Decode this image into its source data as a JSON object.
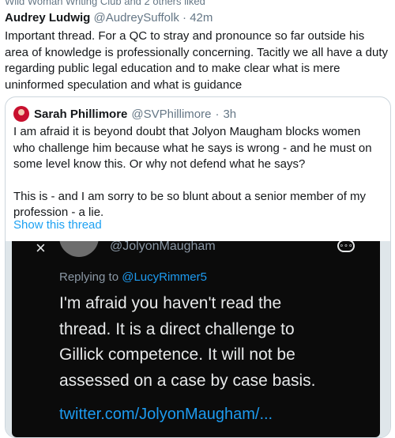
{
  "social_context": "Wild Woman Writing Club and 2 others liked",
  "tweet": {
    "name": "Audrey Ludwig",
    "handle": "@AudreySuffolk",
    "time": "42m",
    "text": "Important thread. For a QC to stray and pronounce so far outside his area of knowledge is professionally concerning. Tacitly we all have a duty regarding public legal education and to make clear what is mere uninformed speculation and what is guidance"
  },
  "quote": {
    "name": "Sarah Phillimore",
    "handle": "@SVPhillimore",
    "time": "3h",
    "paragraph1": "I am afraid it is beyond doubt that Jolyon Maugham blocks women who challenge him because what he says is wrong - and he must on some level know this. Or why not defend what he says?",
    "paragraph2": "This is - and I am sorry to be so blunt about a senior member of my profession - a lie.",
    "show_thread": "Show this thread"
  },
  "media": {
    "close_glyph": "×",
    "more_glyph": "∘∘∘",
    "handle": "@JolyonMaugham",
    "replying_prefix": "Replying to ",
    "replying_to": "@LucyRimmer5",
    "text": "I'm afraid you haven't read the thread. It is a direct challenge to Gillick competence. It will not be assessed on a case by case basis.",
    "link": "twitter.com/JolyonMaugham/..."
  }
}
